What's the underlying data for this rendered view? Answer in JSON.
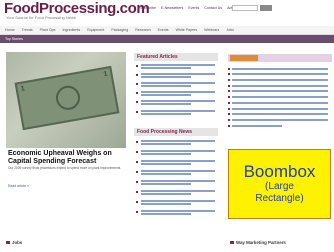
{
  "header": {
    "logo": "FoodProcessing.com",
    "tagline": "Your Source for Food Processing News",
    "top_links": [
      "Subscribe",
      "E-Newsletters",
      "Events",
      "Contact Us",
      "Advertise"
    ]
  },
  "nav": {
    "items": [
      "Home",
      "Trends",
      "Plant Ops",
      "Ingredients",
      "Equipment",
      "Packaging",
      "Research",
      "Events",
      "White Papers",
      "Webinars",
      "Jobs"
    ]
  },
  "breadcrumb": "Top Stories",
  "feature": {
    "title": "Economic Upheaval Weighs on Capital Spending Forecast",
    "summary": "Our 2009 survey finds processors expect to spend more on plant improvements",
    "more": "Read article »"
  },
  "middle": {
    "featured_heading": "Featured Articles",
    "news_heading": "Food Processing News"
  },
  "sidebar_right": {
    "tab_label": "Top Stories"
  },
  "ad": {
    "line1": "Boombox",
    "line2": "(Large",
    "line3": "Rectangle)"
  },
  "bottom": {
    "left_title": "Jobs",
    "right_title": "Way Marketing Partners"
  }
}
